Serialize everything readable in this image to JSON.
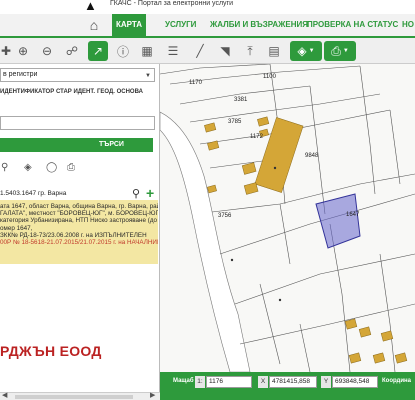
{
  "header": {
    "tagline": "ГКАЧС - Портал за електронни услуги"
  },
  "nav": {
    "tabs": [
      {
        "label": "КАРТА",
        "active": true
      },
      {
        "label": "УСЛУГИ"
      },
      {
        "label": "ЖАЛБИ И ВЪЗРАЖЕНИЯ"
      },
      {
        "label": "ПРОВЕРКА НА СТАТУС"
      },
      {
        "label": "НО"
      }
    ]
  },
  "left_panel": {
    "select_value": "в регистри",
    "tabs": [
      "ИДЕНТИФИКАТОР",
      "СТАР ИДЕНТ.",
      "ГЕОД. ОСНОВА"
    ],
    "search_button": "ТЪРСИ",
    "result_header": "1.5403.1647 гр. Варна",
    "result_lines": [
      {
        "text": "ата 1647, област Варна, община Варна, гр. Варна, район",
        "red": false
      },
      {
        "text": "ГАЛАТА\", местност \"БОРОВЕЦ-ЮГ\", м. БОРОВЕЦ-ЮГ,",
        "red": false
      },
      {
        "text": "категория Урбанизирана, НТП Ниско застрояване (до 10",
        "red": false
      },
      {
        "text": "омер 1647,",
        "red": false
      },
      {
        "text": "ЗКК№ РД-18-73/23.06.2008 г. на ИЗПЪЛНИТЕЛЕН",
        "red": false
      },
      {
        "text": "00Р № 18-5618-21.07.2015/21.07.2015 г. на НАЧАЛНИК",
        "red": true
      }
    ],
    "company": "РДЖЪН ЕООД"
  },
  "map": {
    "labels": [
      {
        "text": "1170"
      },
      {
        "text": "1100"
      },
      {
        "text": "3381"
      },
      {
        "text": "3785"
      },
      {
        "text": "1172"
      },
      {
        "text": "9848"
      },
      {
        "text": "3756"
      },
      {
        "text": "1647"
      }
    ],
    "selected_parcel_color": "#6666cc"
  },
  "statusbar": {
    "scale_label": "Мащаб",
    "scale_tag": "1:",
    "scale_value": "1176",
    "x_tag": "X",
    "x_value": "4781415,858",
    "y_tag": "Y",
    "y_value": "693848,548",
    "coords_label": "Координа"
  },
  "colors": {
    "brand_green": "#2e9a3c",
    "result_bg": "#f3e7a3",
    "building_fill": "#d4a637",
    "company_red": "#b22222"
  }
}
